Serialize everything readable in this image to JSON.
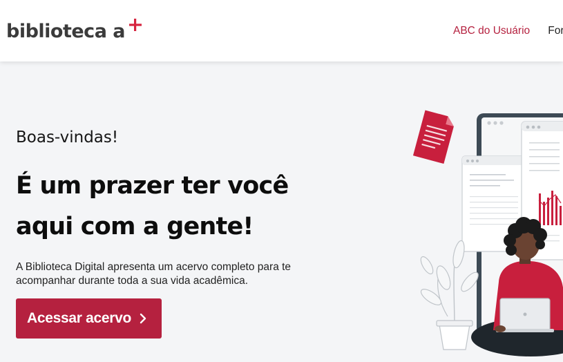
{
  "header": {
    "logo_text": "biblioteca a",
    "nav": [
      {
        "label": "ABC do Usuário"
      },
      {
        "label": "For"
      }
    ]
  },
  "hero": {
    "greeting": "Boas-vindas!",
    "headline_line1": "É um prazer ter você",
    "headline_line2": "aqui com a gente!",
    "description": "A Biblioteca Digital apresenta um acervo completo para te acompanhar durante toda a sua vida acadêmica.",
    "cta_label": "Acessar acervo"
  },
  "colors": {
    "accent": "#b5213f",
    "background": "#f4f5f7",
    "header_bg": "#ffffff",
    "text_dark": "#0d0d0d"
  },
  "icons": {
    "logo_mark": "plus-icon",
    "cta": "chevron-right-icon"
  }
}
